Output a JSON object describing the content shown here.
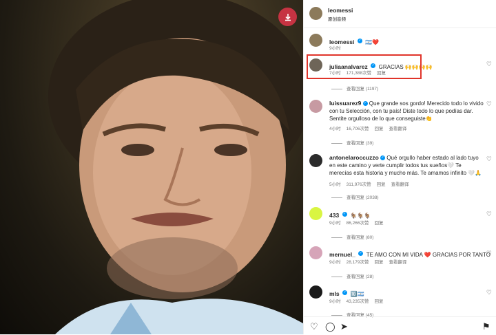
{
  "post": {
    "author": "leomessi",
    "subtitle": "原创音频"
  },
  "caption": {
    "username": "leomessi",
    "text": "🇦🇷❤️",
    "time": "9小时"
  },
  "comments": [
    {
      "username": "juliaanalvarez",
      "verified": true,
      "text": "GRACIAS 🙌🙌🙌🙌",
      "time": "7小时",
      "likes": "171,388次赞",
      "reply": "回复",
      "view_replies": "查看回复 (1197)"
    },
    {
      "username": "luissuarez9",
      "verified": true,
      "text": "Que grande sos gordo! Merecido todo lo vivido con tu Selección, con tu país! Diste todo lo que podías dar. Sentite orgulloso de lo que conseguiste👏",
      "time": "4小时",
      "likes": "16,706次赞",
      "reply": "回复",
      "translate": "查看翻译",
      "view_replies": "查看回复 (39)"
    },
    {
      "username": "antonelaroccuzzo",
      "verified": true,
      "text": "Qué orgullo haber estado al lado tuyo en este camino y verte cumplir todos tus sueños🤍 Te merecías esta historia y mucho más. Te amamos infinito 🤍🙏",
      "time": "5小时",
      "likes": "311,976次赞",
      "reply": "回复",
      "translate": "查看翻译",
      "view_replies": "查看回复 (2038)"
    },
    {
      "username": "433",
      "verified": true,
      "text": "🐐🐐🐐",
      "time": "9小时",
      "likes": "86,266次赞",
      "reply": "回复",
      "view_replies": "查看回复 (80)"
    },
    {
      "username": "mernuel_",
      "verified": true,
      "text": "TE AMO CON MI VIDA ❤️ GRACIAS POR TANTO",
      "time": "9小时",
      "likes": "28,179次赞",
      "reply": "回复",
      "translate": "查看翻译",
      "view_replies": "查看回复 (28)"
    },
    {
      "username": "mls",
      "verified": true,
      "text": "🔟🇦🇷",
      "time": "9小时",
      "likes": "43,235次赞",
      "reply": "回复",
      "view_replies": "查看回复 (45)"
    }
  ],
  "colors": {
    "accent": "#0095f6",
    "highlight": "#e0342a",
    "download": "#c63342",
    "heart_red": "#e0342a"
  }
}
